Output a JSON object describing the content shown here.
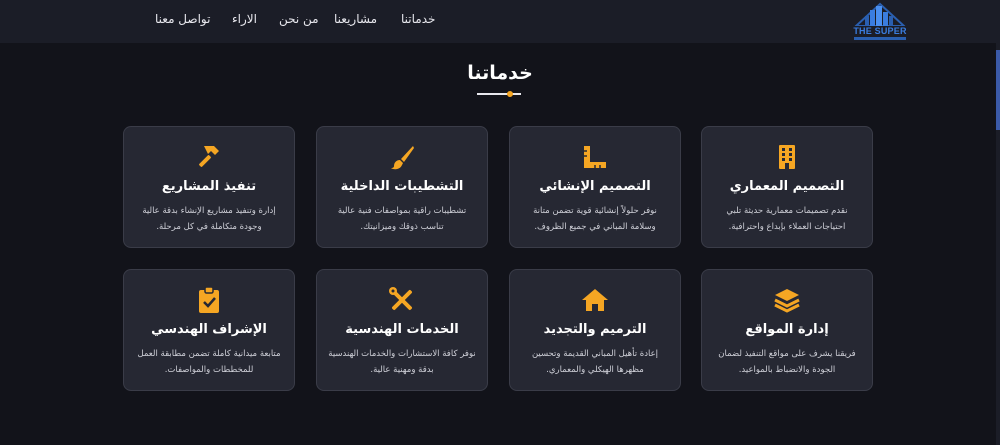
{
  "header": {
    "logo_text": "THE SUPER",
    "nav": [
      {
        "label": "خدماتنا",
        "name": "nav-services"
      },
      {
        "label": "مشاريعنا",
        "name": "nav-projects"
      },
      {
        "label": "من نحن",
        "name": "nav-about"
      },
      {
        "label": "الاراء",
        "name": "nav-reviews"
      },
      {
        "label": "تواصل معنا",
        "name": "nav-contact"
      }
    ]
  },
  "section": {
    "title": "خدماتنا"
  },
  "colors": {
    "accent": "#f5a623",
    "background": "#12131a",
    "card": "#262833",
    "header": "#1b1d27"
  },
  "cards": [
    {
      "icon": "building-icon",
      "title": "التصميم المعماري",
      "desc": "نقدم تصميمات معمارية حديثة تلبي احتياجات العملاء بإبداع واحترافية."
    },
    {
      "icon": "ruler-icon",
      "title": "التصميم الإنشائي",
      "desc": "نوفر حلولاً إنشائية قوية تضمن متانة وسلامة المباني في جميع الظروف."
    },
    {
      "icon": "paint-brush-icon",
      "title": "التشطيبات الداخلية",
      "desc": "تشطيبات راقية بمواصفات فنية عالية تناسب ذوقك وميزانيتك."
    },
    {
      "icon": "hammer-icon",
      "title": "تنفيذ المشاريع",
      "desc": "إدارة وتنفيذ مشاريع الإنشاء بدقة عالية وجودة متكاملة في كل مرحلة."
    },
    {
      "icon": "layers-icon",
      "title": "إدارة المواقع",
      "desc": "فريقنا يشرف على مواقع التنفيذ لضمان الجودة والانضباط بالمواعيد."
    },
    {
      "icon": "home-icon",
      "title": "الترميم والتجديد",
      "desc": "إعادة تأهيل المباني القديمة وتحسين مظهرها الهيكلي والمعماري."
    },
    {
      "icon": "tools-icon",
      "title": "الخدمات الهندسية",
      "desc": "نوفر كافة الاستشارات والخدمات الهندسية بدقة ومهنية عالية."
    },
    {
      "icon": "clipboard-check-icon",
      "title": "الإشراف الهندسي",
      "desc": "متابعة ميدانية كاملة تضمن مطابقة العمل للمخططات والمواصفات."
    }
  ]
}
